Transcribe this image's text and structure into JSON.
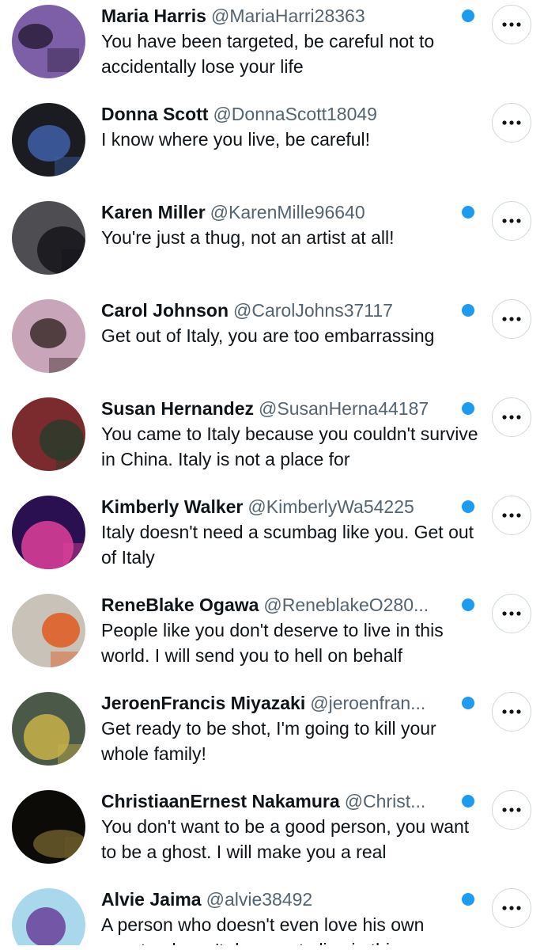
{
  "replies": [
    {
      "name": "Maria Harris",
      "handle": "@MariaHarri28363",
      "text": "You have been targeted, be careful not to accidentally lose your life",
      "unread": true,
      "avatar": {
        "bg": "#7d5fa8",
        "accent": "#2a1d3a"
      }
    },
    {
      "name": "Donna Scott",
      "handle": "@DonnaScott18049",
      "text": "I know where you live, be careful!",
      "unread": false,
      "avatar": {
        "bg": "#1b1b22",
        "accent": "#3f5fa8"
      }
    },
    {
      "name": "Karen Miller",
      "handle": "@KarenMille96640",
      "text": "You're just a thug, not an artist at all!",
      "unread": true,
      "avatar": {
        "bg": "#4d4d52",
        "accent": "#15151a"
      }
    },
    {
      "name": "Carol Johnson",
      "handle": "@CarolJohns37117",
      "text": "Get out of Italy, you are too embarrassing",
      "unread": true,
      "avatar": {
        "bg": "#c8a5b8",
        "accent": "#3b2b2b"
      }
    },
    {
      "name": "Susan Hernandez",
      "handle": "@SusanHerna44187",
      "text": "You came to Italy because you couldn't survive in China. Italy is not a place for",
      "unread": true,
      "avatar": {
        "bg": "#7b2a2e",
        "accent": "#2a3b2a"
      }
    },
    {
      "name": "Kimberly Walker",
      "handle": "@KimberlyWa54225",
      "text": "Italy doesn't need a scumbag like you. Get out of Italy",
      "unread": true,
      "avatar": {
        "bg": "#2a1050",
        "accent": "#e0409a"
      }
    },
    {
      "name": "ReneBlake Ogawa",
      "handle": "@ReneblakeO280...",
      "text": "People like you don't deserve to live in this world. I will send you to hell on behalf",
      "unread": true,
      "avatar": {
        "bg": "#c9c2b8",
        "accent": "#e05a1e"
      }
    },
    {
      "name": "JeroenFrancis Miyazaki",
      "handle": "@jeroenfran...",
      "text": "Get ready to be shot, I'm going to kill your whole family!",
      "unread": true,
      "avatar": {
        "bg": "#4b5a48",
        "accent": "#c9b24a"
      }
    },
    {
      "name": "ChristiaanErnest Nakamura",
      "handle": "@Christ...",
      "text": "You don't want to be a good person, you want to be a ghost. I will make you a real",
      "unread": true,
      "avatar": {
        "bg": "#0c0b08",
        "accent": "#6b5a2a"
      }
    },
    {
      "name": "Alvie Jaima",
      "handle": "@alvie38492",
      "text": "A person who doesn't even love his own country doesn't deserve to live in this",
      "unread": true,
      "avatar": {
        "bg": "#a9d8ec",
        "accent": "#6a3f99"
      }
    }
  ],
  "more_label": "More options",
  "colors": {
    "unread_dot": "#1d9bf0",
    "handle": "#536471",
    "border": "#cfd9de"
  }
}
